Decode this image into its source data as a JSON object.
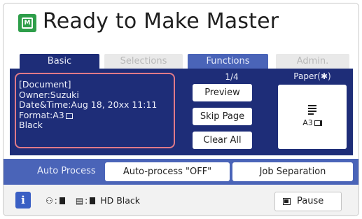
{
  "header": {
    "title": "Ready to Make Master",
    "icon": "master-icon",
    "icon_glyph": "M",
    "icon_color": "#2e9e4a"
  },
  "tabs": [
    {
      "label": "Basic",
      "state": "active"
    },
    {
      "label": "Selections",
      "state": "disabled"
    },
    {
      "label": "Functions",
      "state": "enabled"
    },
    {
      "label": "Admin.",
      "state": "disabled"
    }
  ],
  "document": {
    "lines": [
      "[Document]",
      "Owner:Suzuki",
      "Date&Time:Aug 18, 20xx 11:11",
      "Format:A3",
      "Black"
    ]
  },
  "page_count": "1/4",
  "actions": {
    "preview": "Preview",
    "skip_page": "Skip Page",
    "clear_all": "Clear All"
  },
  "paper": {
    "label": "Paper(✱)",
    "size": "A3",
    "icon": "paper-tray-icon"
  },
  "auto_process": {
    "label": "Auto Process",
    "button": "Auto-process \"OFF\"",
    "job_separation": "Job Separation"
  },
  "status": {
    "info_glyph": "i",
    "ink": "HD Black",
    "pause": "Pause"
  },
  "colors": {
    "panel": "#1e2d78",
    "functions_tab": "#4a64b8",
    "highlight_border": "#e07a88"
  }
}
